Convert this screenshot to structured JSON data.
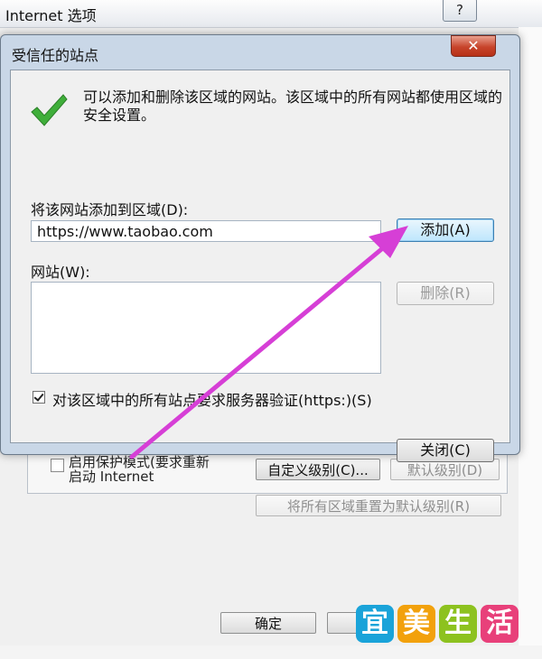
{
  "background_window": {
    "title": "Internet 选项",
    "help_button": "?",
    "protected_mode_label": "启用保护模式(要求重新\n启动 Internet",
    "custom_level_button": "自定义级别(C)...",
    "default_level_button": "默认级别(D)",
    "reset_all_zones_button": "将所有区域重置为默认级别(R)",
    "ok_button": "确定"
  },
  "dialog": {
    "title": "受信任的站点",
    "close_glyph": "✕",
    "info_text": "可以添加和删除该区域的网站。该区域中的所有网站都使用区域的安全设置。",
    "add_label": "将该网站添加到区域(D):",
    "url_value": "https://www.taobao.com",
    "add_button": "添加(A)",
    "sites_label": "网站(W):",
    "remove_button": "删除(R)",
    "https_checkbox_label": "对该区域中的所有站点要求服务器验证(https:)(S)",
    "https_checked": true,
    "close_button": "关闭(C)"
  },
  "watermark": {
    "chars": [
      "宜",
      "美",
      "生",
      "活"
    ],
    "colors": [
      "#1aa3d9",
      "#f2a10c",
      "#8dc21f",
      "#e8407a"
    ]
  },
  "annotation": {
    "arrow_color": "#d63fd6"
  },
  "icons": {
    "check": "green-check-icon",
    "close": "close-icon"
  }
}
